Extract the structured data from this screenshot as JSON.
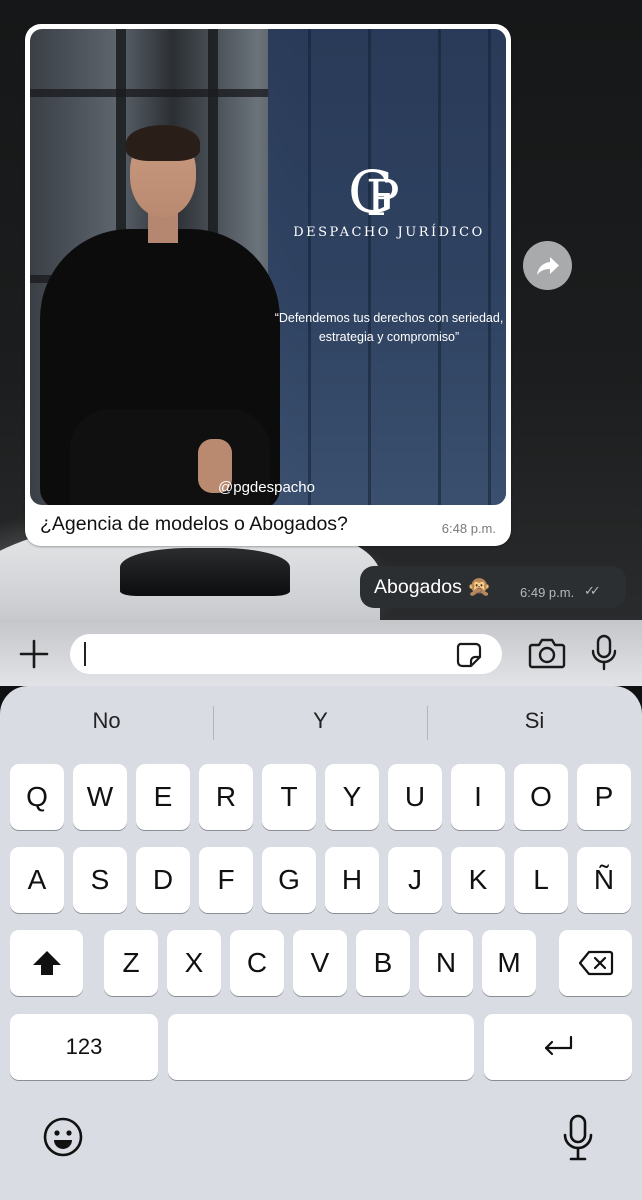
{
  "chat": {
    "image_message": {
      "firm_name": "DESPACHO JURÍDICO",
      "logo_letters": {
        "first": "G",
        "second": "P"
      },
      "quote": "“Defendemos tus derechos con seriedad, estrategia y compromiso”",
      "handle": "@pgdespacho",
      "caption": "¿Agencia de modelos o Abogados?",
      "time": "6:48 p.m."
    },
    "outgoing_message": {
      "text": "Abogados",
      "emoji": "🙊",
      "time": "6:49 p.m.",
      "status_ticks": "✓✓"
    },
    "forward_icon": "forward-arrow-icon"
  },
  "composer": {
    "input_value": "",
    "icons": [
      "plus-icon",
      "sticker-icon",
      "camera-icon",
      "microphone-icon"
    ]
  },
  "keyboard": {
    "suggestions": [
      "No",
      "Y",
      "Si"
    ],
    "row1": [
      "Q",
      "W",
      "E",
      "R",
      "T",
      "Y",
      "U",
      "I",
      "O",
      "P"
    ],
    "row2": [
      "A",
      "S",
      "D",
      "F",
      "G",
      "H",
      "J",
      "K",
      "L",
      "Ñ"
    ],
    "row3": [
      "Z",
      "X",
      "C",
      "V",
      "B",
      "N",
      "M"
    ],
    "numbers_label": "123",
    "icons": [
      "shift-icon",
      "backspace-icon",
      "return-icon",
      "emoji-icon",
      "dictation-mic-icon"
    ]
  },
  "colors": {
    "incoming_bubble": "#ffffff",
    "outgoing_bubble": "#2c2f31",
    "brand_panel": "#2e4262",
    "keyboard_bg": "#d9dce3"
  }
}
